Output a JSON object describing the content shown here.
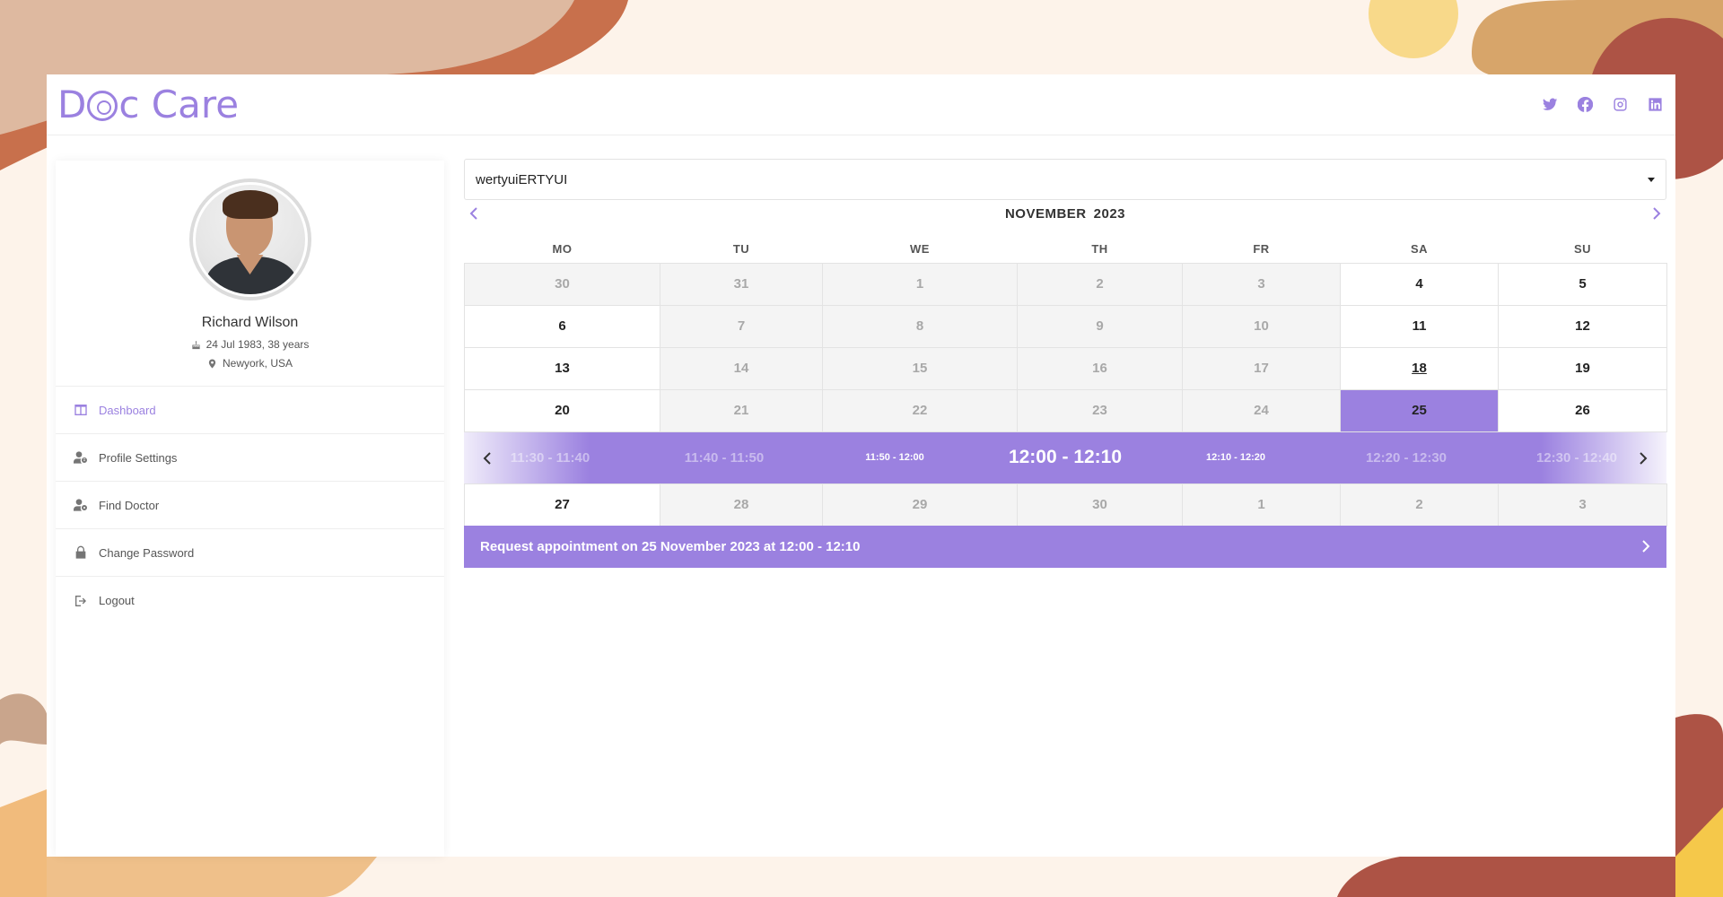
{
  "brand": {
    "logo_text_1": "D",
    "logo_text_2": "c Care"
  },
  "socials": [
    "twitter-icon",
    "facebook-icon",
    "instagram-icon",
    "linkedin-icon"
  ],
  "profile": {
    "name": "Richard Wilson",
    "dob": "24 Jul 1983, 38 years",
    "location": "Newyork, USA"
  },
  "menu": {
    "dashboard": "Dashboard",
    "profile_settings": "Profile Settings",
    "find_doctor": "Find Doctor",
    "change_password": "Change Password",
    "logout": "Logout"
  },
  "select": {
    "value": "wertyuiERTYUI"
  },
  "calendar": {
    "month": "NOVEMBER",
    "year": "2023",
    "weekdays": [
      "MO",
      "TU",
      "WE",
      "TH",
      "FR",
      "SA",
      "SU"
    ],
    "weeks": [
      [
        {
          "d": "30",
          "s": "off"
        },
        {
          "d": "31",
          "s": "off"
        },
        {
          "d": "1",
          "s": "off"
        },
        {
          "d": "2",
          "s": "off"
        },
        {
          "d": "3",
          "s": "off"
        },
        {
          "d": "4",
          "s": "on"
        },
        {
          "d": "5",
          "s": "on"
        }
      ],
      [
        {
          "d": "6",
          "s": "on"
        },
        {
          "d": "7",
          "s": "off"
        },
        {
          "d": "8",
          "s": "off"
        },
        {
          "d": "9",
          "s": "off"
        },
        {
          "d": "10",
          "s": "off"
        },
        {
          "d": "11",
          "s": "on"
        },
        {
          "d": "12",
          "s": "on"
        }
      ],
      [
        {
          "d": "13",
          "s": "on"
        },
        {
          "d": "14",
          "s": "off"
        },
        {
          "d": "15",
          "s": "off"
        },
        {
          "d": "16",
          "s": "off"
        },
        {
          "d": "17",
          "s": "off"
        },
        {
          "d": "18",
          "s": "today"
        },
        {
          "d": "19",
          "s": "on"
        }
      ],
      [
        {
          "d": "20",
          "s": "on"
        },
        {
          "d": "21",
          "s": "off"
        },
        {
          "d": "22",
          "s": "off"
        },
        {
          "d": "23",
          "s": "off"
        },
        {
          "d": "24",
          "s": "off"
        },
        {
          "d": "25",
          "s": "selected"
        },
        {
          "d": "26",
          "s": "on"
        }
      ]
    ],
    "last_week": [
      {
        "d": "27",
        "s": "on"
      },
      {
        "d": "28",
        "s": "off"
      },
      {
        "d": "29",
        "s": "off"
      },
      {
        "d": "30",
        "s": "off"
      },
      {
        "d": "1",
        "s": "off"
      },
      {
        "d": "2",
        "s": "off"
      },
      {
        "d": "3",
        "s": "off"
      }
    ]
  },
  "timeslots": {
    "slots": [
      "11:30 - 11:40",
      "11:40 - 11:50",
      "11:50 - 12:00",
      "12:00 - 12:10",
      "12:10 - 12:20",
      "12:20 - 12:30",
      "12:30 - 12:40"
    ],
    "selected_index": 3
  },
  "request": {
    "label": "Request appointment on 25 November 2023 at 12:00 - 12:10"
  },
  "colors": {
    "accent": "#9b81e0",
    "background": "#fdf3ea",
    "off_cell": "#f4f4f4"
  }
}
